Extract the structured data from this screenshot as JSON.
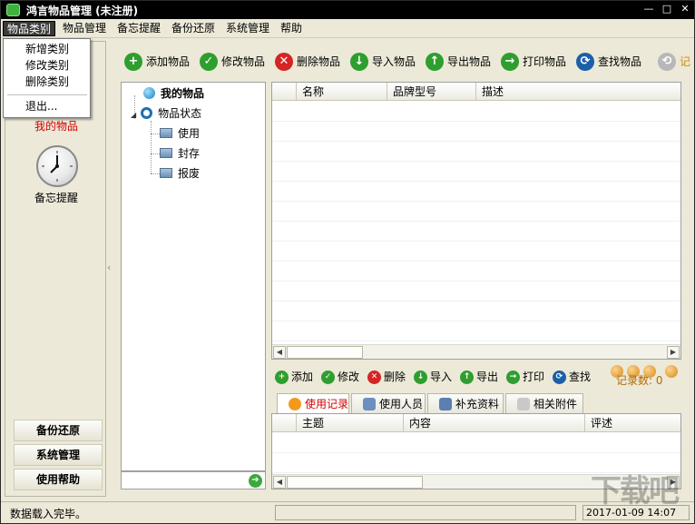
{
  "window": {
    "title": "鸿言物品管理 (未注册)",
    "controls": [
      "—",
      "□",
      "✕"
    ]
  },
  "menubar": {
    "items": [
      "物品类别",
      "物品管理",
      "备忘提醒",
      "备份还原",
      "系统管理",
      "帮助"
    ],
    "active_index": 0
  },
  "dropdown": {
    "items": [
      "新增类别",
      "修改类别",
      "删除类别",
      "退出..."
    ]
  },
  "leftnav": {
    "items_label_active": "我的物品",
    "reminder_label": "备忘提醒",
    "buttons": [
      "备份还原",
      "系统管理",
      "使用帮助"
    ],
    "icons": {
      "clock": "clock-icon"
    }
  },
  "toolbar": {
    "buttons": [
      {
        "label": "添加物品",
        "icon": "add-icon",
        "color": "#2e9e2e",
        "glyph": "+"
      },
      {
        "label": "修改物品",
        "icon": "check-icon",
        "color": "#2e9e2e",
        "glyph": "✓"
      },
      {
        "label": "删除物品",
        "icon": "delete-icon",
        "color": "#d42424",
        "glyph": "✕"
      },
      {
        "label": "导入物品",
        "icon": "import-icon",
        "color": "#2e9e2e",
        "glyph": "↓"
      },
      {
        "label": "导出物品",
        "icon": "export-icon",
        "color": "#2e9e2e",
        "glyph": "↑"
      },
      {
        "label": "打印物品",
        "icon": "print-icon",
        "color": "#2e9e2e",
        "glyph": "→"
      },
      {
        "label": "查找物品",
        "icon": "search-icon",
        "color": "#1b5fa8",
        "glyph": "⟳"
      },
      {
        "label": "记",
        "icon": "record-icon",
        "color": "#b8b8b8",
        "glyph": "⟲"
      }
    ]
  },
  "tree": {
    "root": "我的物品",
    "status_node": "物品状态",
    "children": [
      "使用",
      "封存",
      "报废"
    ]
  },
  "grid": {
    "columns": [
      "",
      "名称",
      "品牌型号",
      "描述"
    ]
  },
  "toolbar2": {
    "buttons": [
      {
        "label": "添加",
        "icon": "add-icon",
        "color": "#2e9e2e",
        "glyph": "+"
      },
      {
        "label": "修改",
        "icon": "check-icon",
        "color": "#2e9e2e",
        "glyph": "✓"
      },
      {
        "label": "删除",
        "icon": "delete-icon",
        "color": "#d42424",
        "glyph": "✕"
      },
      {
        "label": "导入",
        "icon": "import-icon",
        "color": "#2e9e2e",
        "glyph": "↓"
      },
      {
        "label": "导出",
        "icon": "export-icon",
        "color": "#2e9e2e",
        "glyph": "↑"
      },
      {
        "label": "打印",
        "icon": "print-icon",
        "color": "#2e9e2e",
        "glyph": "→"
      },
      {
        "label": "查找",
        "icon": "search-icon",
        "color": "#1b5fa8",
        "glyph": "⟳"
      }
    ],
    "record_count": "记录数: 0"
  },
  "tabs": {
    "items": [
      "使用记录",
      "使用人员",
      "补充资料",
      "相关附件"
    ],
    "active_index": 0
  },
  "grid2": {
    "columns": [
      "",
      "主题",
      "内容",
      "评述"
    ]
  },
  "status": {
    "text": "数据载入完毕。",
    "datetime": "2017-01-09 14:07"
  },
  "watermark": "下载吧"
}
